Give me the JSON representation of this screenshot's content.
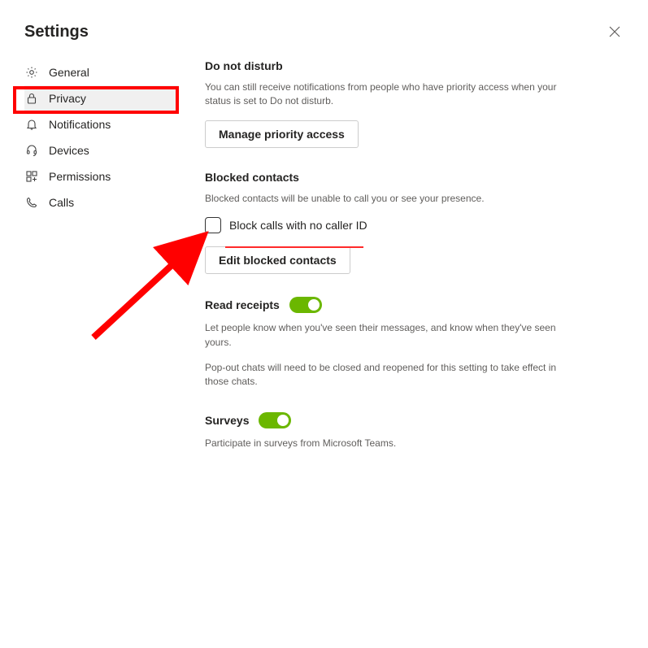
{
  "header": {
    "title": "Settings"
  },
  "sidebar": {
    "items": [
      {
        "label": "General"
      },
      {
        "label": "Privacy"
      },
      {
        "label": "Notifications"
      },
      {
        "label": "Devices"
      },
      {
        "label": "Permissions"
      },
      {
        "label": "Calls"
      }
    ]
  },
  "main": {
    "dnd": {
      "title": "Do not disturb",
      "desc": "You can still receive notifications from people who have priority access when your status is set to Do not disturb.",
      "button": "Manage priority access"
    },
    "blocked": {
      "title": "Blocked contacts",
      "desc": "Blocked contacts will be unable to call you or see your presence.",
      "checkbox_label": "Block calls with no caller ID",
      "button": "Edit blocked contacts"
    },
    "read": {
      "title": "Read receipts",
      "desc1": "Let people know when you've seen their messages, and know when they've seen yours.",
      "desc2": "Pop-out chats will need to be closed and reopened for this setting to take effect in those chats."
    },
    "surveys": {
      "title": "Surveys",
      "desc": "Participate in surveys from Microsoft Teams."
    }
  }
}
